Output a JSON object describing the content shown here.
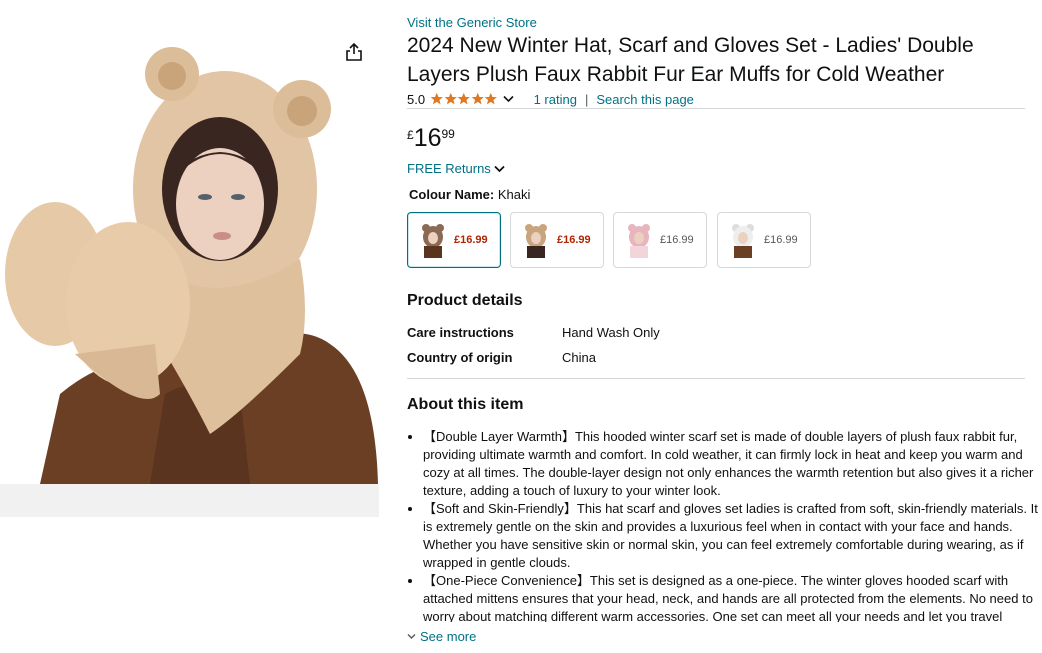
{
  "store_link": "Visit the Generic Store",
  "title": "2024 New Winter Hat, Scarf and Gloves Set - Ladies' Double Layers Plush Faux Rabbit Fur Ear Muffs for Cold Weather",
  "rating": {
    "value": "5.0",
    "stars": 5,
    "count_text": "1 rating",
    "separator": "|",
    "search_text": "Search this page"
  },
  "price": {
    "symbol": "£",
    "whole": "16",
    "fraction": "99"
  },
  "returns": "FREE Returns",
  "colour": {
    "label": "Colour Name:",
    "value": "Khaki"
  },
  "swatches": [
    {
      "price": "£16.99",
      "selected": true,
      "deal": true,
      "color": "#8a6a55"
    },
    {
      "price": "£16.99",
      "selected": false,
      "deal": true,
      "color": "#c9a57d"
    },
    {
      "price": "£16.99",
      "selected": false,
      "deal": false,
      "color": "#e8b4bd"
    },
    {
      "price": "£16.99",
      "selected": false,
      "deal": false,
      "color": "#eeeeee"
    }
  ],
  "product_details": {
    "heading": "Product details",
    "rows": [
      {
        "key": "Care instructions",
        "value": "Hand Wash Only"
      },
      {
        "key": "Country of origin",
        "value": "China"
      }
    ]
  },
  "about": {
    "heading": "About this item",
    "bullets": [
      "【Double Layer Warmth】This hooded winter scarf set is made of double layers of plush faux rabbit fur, providing ultimate warmth and comfort. In cold weather, it can firmly lock in heat and keep you warm and cozy at all times. The double-layer design not only enhances the warmth retention but also gives it a richer texture, adding a touch of luxury to your winter look.",
      "【Soft and Skin-Friendly】This hat scarf and gloves set ladies is crafted from soft, skin-friendly materials. It is extremely gentle on the skin and provides a luxurious feel when in contact with your face and hands. Whether you have sensitive skin or normal skin, you can feel extremely comfortable during wearing, as if wrapped in gentle clouds.",
      "【One-Piece Convenience】This set is designed as a one-piece. The winter gloves hooded scarf with attached mittens ensures that your head, neck, and hands are all protected from the elements. No need to worry about matching different warm accessories. One set can meet all your needs and let you travel"
    ],
    "see_more": "See more"
  },
  "colors": {
    "link": "#007185",
    "deal": "#b12704",
    "star": "#de7921",
    "text": "#0f1111"
  }
}
